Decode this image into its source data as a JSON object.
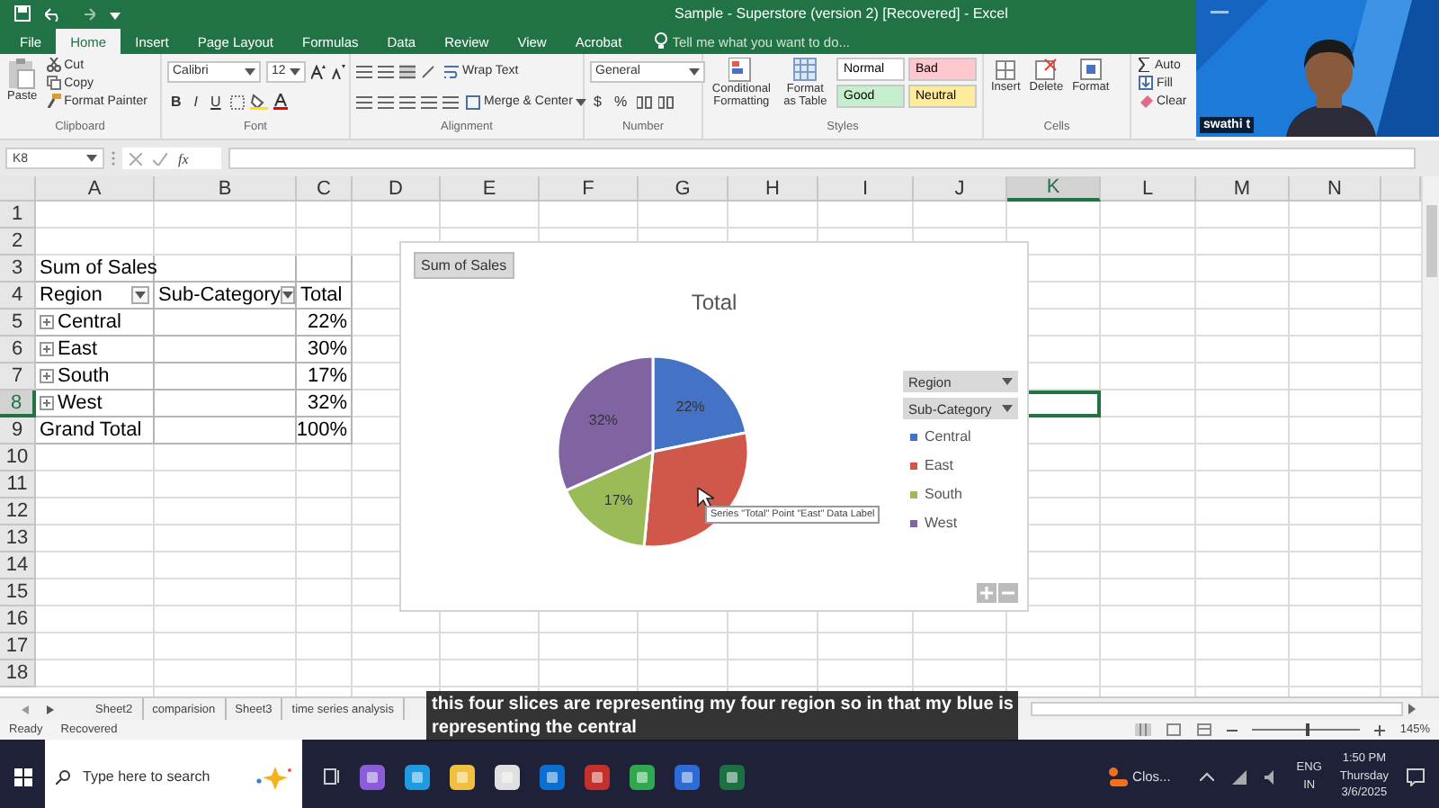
{
  "window": {
    "title": "Sample - Superstore (version 2) [Recovered] - Excel"
  },
  "tabs": [
    {
      "label": "File",
      "selected": false
    },
    {
      "label": "Home",
      "selected": true
    },
    {
      "label": "Insert",
      "selected": false
    },
    {
      "label": "Page Layout",
      "selected": false
    },
    {
      "label": "Formulas",
      "selected": false
    },
    {
      "label": "Data",
      "selected": false
    },
    {
      "label": "Review",
      "selected": false
    },
    {
      "label": "View",
      "selected": false
    },
    {
      "label": "Acrobat",
      "selected": false
    }
  ],
  "tell_me": {
    "placeholder": "Tell me what you want to do..."
  },
  "ribbon": {
    "clipboard": {
      "label": "Clipboard",
      "paste": "Paste",
      "items": [
        "Cut",
        "Copy",
        "Format Painter"
      ]
    },
    "font": {
      "label": "Font",
      "name": "Calibri",
      "size": "12",
      "buttons": [
        "B",
        "I",
        "U"
      ]
    },
    "alignment": {
      "label": "Alignment",
      "wrap": "Wrap Text",
      "merge": "Merge & Center"
    },
    "number": {
      "label": "Number",
      "format": "General",
      "symbols": [
        "$",
        "%"
      ]
    },
    "styles": {
      "label": "Styles",
      "commands": [
        "Conditional Formatting",
        "Format as Table"
      ],
      "gallery": [
        {
          "label": "Normal",
          "color": "#ffffff"
        },
        {
          "label": "Bad",
          "color": "#ffc7ce"
        },
        {
          "label": "Good",
          "color": "#c6efce"
        },
        {
          "label": "Neutral",
          "color": "#ffeb9c"
        }
      ]
    },
    "cells": {
      "label": "Cells",
      "commands": [
        "Insert",
        "Delete",
        "Format"
      ]
    },
    "editing": {
      "commands": [
        "Auto",
        "Fill",
        "Clear"
      ]
    }
  },
  "formula_bar": {
    "name_box": "K8",
    "function_label": "fx"
  },
  "columns": [
    {
      "label": "A",
      "selected": false
    },
    {
      "label": "B",
      "selected": false
    },
    {
      "label": "C",
      "selected": false
    },
    {
      "label": "D",
      "selected": false
    },
    {
      "label": "E",
      "selected": false
    },
    {
      "label": "F",
      "selected": false
    },
    {
      "label": "G",
      "selected": false
    },
    {
      "label": "H",
      "selected": false
    },
    {
      "label": "I",
      "selected": false
    },
    {
      "label": "J",
      "selected": false
    },
    {
      "label": "K",
      "selected": true
    },
    {
      "label": "L",
      "selected": false
    },
    {
      "label": "M",
      "selected": false
    },
    {
      "label": "N",
      "selected": false
    }
  ],
  "rows": [
    {
      "label": "1",
      "selected": false
    },
    {
      "label": "2",
      "selected": false
    },
    {
      "label": "3",
      "selected": false
    },
    {
      "label": "4",
      "selected": false
    },
    {
      "label": "5",
      "selected": false
    },
    {
      "label": "6",
      "selected": false
    },
    {
      "label": "7",
      "selected": false
    },
    {
      "label": "8",
      "selected": true
    },
    {
      "label": "9",
      "selected": false
    },
    {
      "label": "10",
      "selected": false
    },
    {
      "label": "11",
      "selected": false
    },
    {
      "label": "12",
      "selected": false
    },
    {
      "label": "13",
      "selected": false
    },
    {
      "label": "14",
      "selected": false
    },
    {
      "label": "15",
      "selected": false
    },
    {
      "label": "16",
      "selected": false
    },
    {
      "label": "17",
      "selected": false
    },
    {
      "label": "18",
      "selected": false
    }
  ],
  "pivot": {
    "title": "Sum of Sales",
    "headers": [
      "Region",
      "Sub-Category",
      "Total"
    ],
    "rows": [
      {
        "label": "Central",
        "value": "22%"
      },
      {
        "label": "East",
        "value": "30%"
      },
      {
        "label": "South",
        "value": "17%"
      },
      {
        "label": "West",
        "value": "32%"
      }
    ],
    "total": {
      "label": "Grand Total",
      "value": "100%"
    }
  },
  "chart": {
    "field_button": "Sum of Sales",
    "legend_fields": [
      "Region",
      "Sub-Category"
    ],
    "legend": [
      {
        "color": "#4472c4"
      },
      {
        "color": "#d0584b"
      },
      {
        "color": "#9bbb59"
      },
      {
        "color": "#8064a2"
      }
    ],
    "tooltip": "Series \"Total\" Point \"East\" Data Label",
    "chart_data": {
      "type": "pie",
      "title": "Total",
      "categories": [
        "Central",
        "East",
        "South",
        "West"
      ],
      "series": [
        {
          "values": [
            22,
            30,
            17,
            32
          ]
        }
      ],
      "value_labels": [
        "22%",
        null,
        "17%",
        "32%"
      ]
    }
  },
  "sheet_tabs": [
    "Sheet2",
    "comparision",
    "Sheet3",
    "time series analysis"
  ],
  "status_bar": {
    "ready": "Ready",
    "recovered": "Recovered",
    "zoom": "145%",
    "zoom_slider": {
      "level": 0.5
    }
  },
  "subtitle": [
    "this four slices are representing my four region so in that my blue is",
    "representing the central"
  ],
  "video": {
    "name": "swathi t"
  },
  "taskbar": {
    "search_placeholder": "Type here to search",
    "notification": "Clos...",
    "language": [
      "ENG",
      "IN"
    ],
    "time": "1:50 PM",
    "day": "Thursday",
    "date": "3/6/2025"
  }
}
